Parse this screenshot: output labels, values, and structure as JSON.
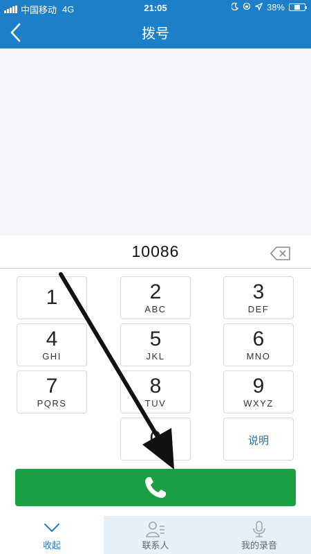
{
  "status_bar": {
    "carrier": "中国移动",
    "network": "4G",
    "time": "21:05",
    "battery_percent": "38%",
    "battery_level": 0.38,
    "icons": [
      "signal-icon",
      "moon-icon",
      "lock-rotation-icon",
      "location-icon",
      "battery-icon"
    ]
  },
  "header": {
    "title": "拨号",
    "back_icon": "chevron-left-icon"
  },
  "dialer": {
    "number": "10086",
    "backspace_icon": "backspace-icon"
  },
  "keypad": {
    "keys": [
      {
        "digit": "1",
        "letters": ""
      },
      {
        "digit": "2",
        "letters": "ABC"
      },
      {
        "digit": "3",
        "letters": "DEF"
      },
      {
        "digit": "4",
        "letters": "GHI"
      },
      {
        "digit": "5",
        "letters": "JKL"
      },
      {
        "digit": "6",
        "letters": "MNO"
      },
      {
        "digit": "7",
        "letters": "PQRS"
      },
      {
        "digit": "8",
        "letters": "TUV"
      },
      {
        "digit": "9",
        "letters": "WXYZ"
      },
      {
        "digit": "0",
        "letters": ""
      },
      {
        "word": "说明"
      }
    ]
  },
  "call_button": {
    "icon": "phone-icon",
    "color": "#1aa042"
  },
  "tabbar": {
    "tabs": [
      {
        "label": "收起",
        "icon": "chevron-down-icon"
      },
      {
        "label": "联系人",
        "icon": "contacts-icon"
      },
      {
        "label": "我的录音",
        "icon": "microphone-icon"
      }
    ]
  },
  "colors": {
    "header": "#1d7fc7",
    "accent_text": "#1d6fb3",
    "history_bg": "#f5f4f9",
    "tab_highlight": "#e5f0f8"
  }
}
